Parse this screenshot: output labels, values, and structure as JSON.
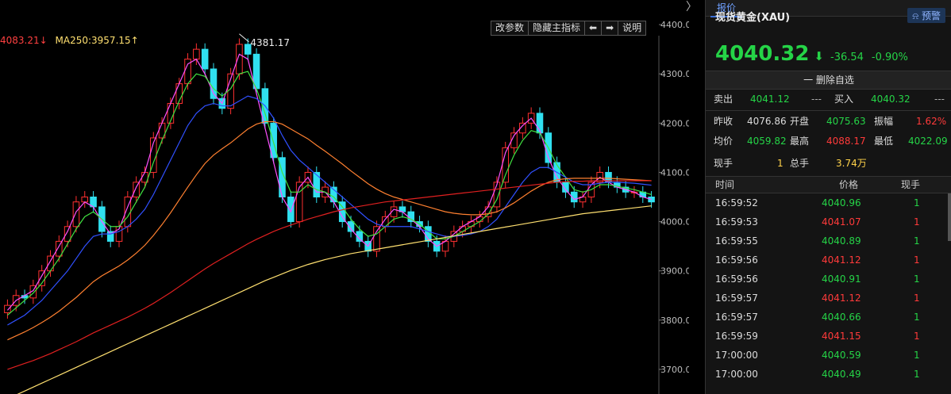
{
  "chart_data": {
    "type": "candlestick",
    "ylim": [
      3650,
      4450
    ],
    "yticks": [
      "4400.00",
      "4300.00",
      "4200.00",
      "4100.00",
      "4000.00",
      "3900.00",
      "3800.00",
      "3700.00"
    ],
    "high_label": "4381.17",
    "ma_legend": [
      {
        "text": "4083.21↓",
        "color": "#ff4040"
      },
      {
        "text": "MA250:3957.15↑",
        "color": "#ffe070"
      }
    ],
    "closes": [
      3830,
      3850,
      3845,
      3870,
      3900,
      3930,
      3960,
      3990,
      4040,
      4050,
      4030,
      3980,
      3960,
      3990,
      4050,
      4080,
      4100,
      4170,
      4200,
      4240,
      4280,
      4330,
      4350,
      4310,
      4250,
      4230,
      4300,
      4360,
      4340,
      4270,
      4200,
      4130,
      4050,
      4000,
      4080,
      4100,
      4050,
      4070,
      4040,
      4000,
      3980,
      3960,
      3940,
      3990,
      4010,
      4030,
      4020,
      4000,
      3990,
      3960,
      3940,
      3960,
      3980,
      3990,
      4000,
      4010,
      4030,
      4080,
      4150,
      4180,
      4200,
      4220,
      4180,
      4120,
      4080,
      4060,
      4040,
      4050,
      4080,
      4100,
      4080,
      4070,
      4060,
      4060,
      4050,
      4040
    ],
    "series": [
      {
        "color": "#ff50ff",
        "values": [
          3820,
          3840,
          3850,
          3860,
          3890,
          3920,
          3950,
          3980,
          4020,
          4040,
          4030,
          4000,
          3975,
          3985,
          4030,
          4070,
          4100,
          4160,
          4200,
          4240,
          4280,
          4320,
          4330,
          4300,
          4260,
          4240,
          4290,
          4340,
          4330,
          4260,
          4190,
          4120,
          4050,
          4020,
          4070,
          4090,
          4060,
          4060,
          4040,
          4010,
          3985,
          3965,
          3950,
          3980,
          4005,
          4025,
          4020,
          4005,
          3990,
          3965,
          3950,
          3960,
          3975,
          3990,
          4000,
          4010,
          4030,
          4075,
          4140,
          4175,
          4195,
          4210,
          4185,
          4130,
          4090,
          4065,
          4045,
          4050,
          4075,
          4090,
          4080,
          4070,
          4065,
          4060,
          4050,
          4045
        ]
      },
      {
        "color": "#40e040",
        "values": [
          3810,
          3825,
          3840,
          3855,
          3875,
          3900,
          3925,
          3955,
          3985,
          4010,
          4020,
          4005,
          3990,
          3990,
          4010,
          4040,
          4070,
          4120,
          4165,
          4205,
          4245,
          4280,
          4300,
          4295,
          4270,
          4255,
          4270,
          4300,
          4305,
          4270,
          4220,
          4160,
          4100,
          4060,
          4060,
          4075,
          4065,
          4060,
          4050,
          4030,
          4005,
          3985,
          3970,
          3975,
          3990,
          4005,
          4010,
          4005,
          3995,
          3980,
          3965,
          3965,
          3970,
          3980,
          3990,
          4000,
          4015,
          4045,
          4095,
          4135,
          4165,
          4185,
          4180,
          4150,
          4115,
          4090,
          4065,
          4060,
          4065,
          4075,
          4075,
          4072,
          4068,
          4065,
          4060,
          4055
        ]
      },
      {
        "color": "#3050ff",
        "values": [
          3790,
          3800,
          3810,
          3825,
          3840,
          3860,
          3880,
          3900,
          3925,
          3950,
          3970,
          3975,
          3975,
          3980,
          3990,
          4005,
          4025,
          4055,
          4090,
          4125,
          4160,
          4195,
          4220,
          4235,
          4240,
          4235,
          4235,
          4245,
          4255,
          4250,
          4235,
          4210,
          4175,
          4145,
          4125,
          4110,
          4095,
          4080,
          4065,
          4050,
          4035,
          4020,
          4005,
          3995,
          3990,
          3990,
          3990,
          3990,
          3985,
          3980,
          3975,
          3970,
          3970,
          3972,
          3975,
          3980,
          3990,
          4005,
          4030,
          4055,
          4080,
          4100,
          4110,
          4110,
          4100,
          4090,
          4080,
          4075,
          4075,
          4078,
          4080,
          4080,
          4079,
          4078,
          4076,
          4074
        ]
      },
      {
        "color": "#ff8030",
        "values": [
          3760,
          3768,
          3776,
          3785,
          3795,
          3806,
          3818,
          3832,
          3846,
          3862,
          3878,
          3890,
          3900,
          3910,
          3922,
          3936,
          3952,
          3972,
          3994,
          4018,
          4044,
          4070,
          4095,
          4118,
          4135,
          4148,
          4160,
          4174,
          4188,
          4198,
          4203,
          4203,
          4198,
          4188,
          4178,
          4168,
          4155,
          4143,
          4130,
          4117,
          4103,
          4090,
          4077,
          4066,
          4057,
          4050,
          4045,
          4040,
          4035,
          4030,
          4025,
          4020,
          4017,
          4015,
          4014,
          4014,
          4016,
          4020,
          4028,
          4038,
          4050,
          4062,
          4072,
          4080,
          4085,
          4087,
          4088,
          4088,
          4088,
          4088,
          4088,
          4087,
          4086,
          4085,
          4084,
          4083
        ]
      },
      {
        "color": "#e02020",
        "values": [
          3700,
          3706,
          3712,
          3718,
          3725,
          3732,
          3740,
          3748,
          3756,
          3765,
          3774,
          3782,
          3790,
          3798,
          3806,
          3815,
          3824,
          3834,
          3845,
          3856,
          3868,
          3880,
          3892,
          3904,
          3915,
          3925,
          3935,
          3945,
          3955,
          3964,
          3972,
          3980,
          3987,
          3993,
          3999,
          4005,
          4010,
          4015,
          4020,
          4024,
          4028,
          4031,
          4034,
          4037,
          4040,
          4042,
          4044,
          4046,
          4048,
          4050,
          4052,
          4054,
          4056,
          4058,
          4060,
          4062,
          4064,
          4066,
          4068,
          4070,
          4072,
          4074,
          4076,
          4078,
          4080,
          4081,
          4082,
          4082,
          4083,
          4083,
          4083,
          4083,
          4083,
          4083,
          4083,
          4083
        ]
      },
      {
        "color": "#ffe070",
        "values": [
          3640,
          3648,
          3656,
          3664,
          3672,
          3680,
          3688,
          3696,
          3704,
          3712,
          3720,
          3728,
          3736,
          3744,
          3752,
          3760,
          3768,
          3776,
          3784,
          3792,
          3800,
          3808,
          3816,
          3824,
          3832,
          3840,
          3848,
          3856,
          3864,
          3872,
          3880,
          3887,
          3894,
          3901,
          3907,
          3913,
          3918,
          3923,
          3927,
          3931,
          3935,
          3938,
          3941,
          3944,
          3947,
          3950,
          3953,
          3956,
          3959,
          3962,
          3965,
          3968,
          3971,
          3974,
          3977,
          3980,
          3983,
          3986,
          3989,
          3992,
          3995,
          3998,
          4001,
          4004,
          4007,
          4010,
          4013,
          4016,
          4018,
          4020,
          4022,
          4024,
          4026,
          4028,
          4030,
          4032
        ]
      }
    ]
  },
  "toolbar": {
    "change_params": "改参数",
    "hide_indicator": "隐藏主指标",
    "left": "⬅",
    "right": "➡",
    "help": "说明",
    "collapse": "〉"
  },
  "panel": {
    "tab": "报价",
    "instrument": "现货黄金(XAU)",
    "alert": "预警",
    "price": "4040.32",
    "arrow": "⬇",
    "change": "-36.54",
    "change_pct": "-0.90%",
    "delete": "一 删除自选",
    "sell_label": "卖出",
    "sell_value": "4041.12",
    "sell_vol": "---",
    "buy_label": "买入",
    "buy_value": "4040.32",
    "buy_vol": "---",
    "stats": {
      "prev_close_label": "昨收",
      "prev_close": "4076.86",
      "open_label": "开盘",
      "open": "4075.63",
      "amp_label": "振幅",
      "amp": "1.62%",
      "avg_label": "均价",
      "avg": "4059.82",
      "high_label": "最高",
      "high": "4088.17",
      "low_label": "最低",
      "low": "4022.09",
      "cur_vol_label": "现手",
      "cur_vol": "1",
      "total_vol_label": "总手",
      "total_vol": "3.74万"
    },
    "list_headers": {
      "time": "时间",
      "price": "价格",
      "vol": "现手"
    },
    "ticks": [
      {
        "time": "16:59:52",
        "price": "4040.96",
        "vol": "1",
        "dir": "g"
      },
      {
        "time": "16:59:53",
        "price": "4041.07",
        "vol": "1",
        "dir": "r"
      },
      {
        "time": "16:59:55",
        "price": "4040.89",
        "vol": "1",
        "dir": "g"
      },
      {
        "time": "16:59:56",
        "price": "4041.12",
        "vol": "1",
        "dir": "r"
      },
      {
        "time": "16:59:56",
        "price": "4040.91",
        "vol": "1",
        "dir": "g"
      },
      {
        "time": "16:59:57",
        "price": "4041.12",
        "vol": "1",
        "dir": "r"
      },
      {
        "time": "16:59:57",
        "price": "4040.66",
        "vol": "1",
        "dir": "g"
      },
      {
        "time": "16:59:59",
        "price": "4041.15",
        "vol": "1",
        "dir": "r"
      },
      {
        "time": "17:00:00",
        "price": "4040.59",
        "vol": "1",
        "dir": "g"
      },
      {
        "time": "17:00:00",
        "price": "4040.49",
        "vol": "1",
        "dir": "g"
      }
    ]
  }
}
